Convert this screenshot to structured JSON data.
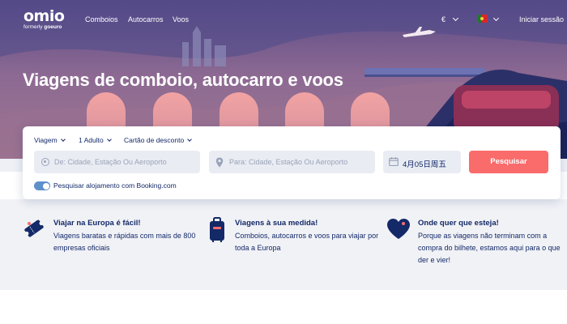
{
  "brand": {
    "name": "omio",
    "tagline_prefix": "formerly",
    "tagline_brand": "goeuro"
  },
  "nav": {
    "links": [
      "Comboios",
      "Autocarros",
      "Voos"
    ],
    "currency": "€",
    "login": "Iniciar sessão"
  },
  "hero": {
    "headline": "Viagens de comboio, autocarro e voos"
  },
  "search": {
    "trip_type": "Viagem",
    "passengers": "1 Adulto",
    "discount_card": "Cartão de desconto",
    "from_placeholder": "De: Cidade, Estação Ou Aeroporto",
    "to_placeholder": "Para: Cidade, Estação Ou Aeroporto",
    "date": "4月05日周五",
    "submit": "Pesquisar",
    "accommodation_toggle": "Pesquisar alojamento com Booking.com"
  },
  "features": [
    {
      "icon": "ticket-icon",
      "title": "Viajar na Europa é fácil!",
      "text": "Viagens baratas e rápidas com mais de 800 empresas oficiais"
    },
    {
      "icon": "luggage-icon",
      "title": "Viagens à sua medida!",
      "text": "Comboios, autocarros e voos para viajar por toda a Europa"
    },
    {
      "icon": "heart-icon",
      "title": "Onde quer que esteja!",
      "text": "Porque as viagens não terminam com a compra do bilhete, estamos aqui para o que der e vier!"
    }
  ],
  "colors": {
    "accent": "#fa6b6b",
    "text": "#132968",
    "toggle": "#5e90cc",
    "field_bg": "#e9ecf3",
    "features_bg": "#f1f2f6"
  }
}
